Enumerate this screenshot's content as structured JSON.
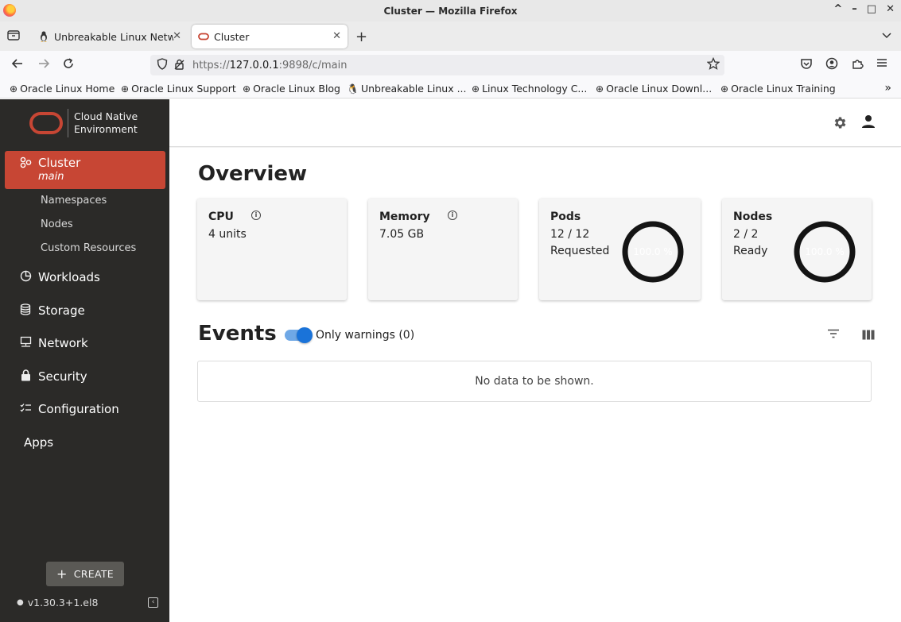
{
  "window": {
    "title": "Cluster — Mozilla Firefox",
    "controls": [
      "^",
      "–",
      "□",
      "✕"
    ]
  },
  "tabs": [
    {
      "label": "Unbreakable Linux Netw",
      "icon": "penguin-icon"
    },
    {
      "label": "Cluster",
      "icon": "oracle-oval-icon"
    }
  ],
  "urlbar": {
    "url_prefix": "https://",
    "url_host": "127.0.0.1",
    "url_rest": ":9898/c/main"
  },
  "bookmarks": [
    "Oracle Linux Home",
    "Oracle Linux Support",
    "Oracle Linux Blog",
    "Unbreakable Linux ...",
    "Linux Technology C...",
    "Oracle Linux Downl...",
    "Oracle Linux Training"
  ],
  "brand": {
    "line1": "Cloud Native",
    "line2": "Environment",
    "color": "#c74634"
  },
  "sidebar": {
    "cluster": {
      "label": "Cluster",
      "sub": "main"
    },
    "sub_items": [
      "Namespaces",
      "Nodes",
      "Custom Resources"
    ],
    "items": [
      {
        "label": "Workloads",
        "icon": "pie-chart-icon"
      },
      {
        "label": "Storage",
        "icon": "database-icon"
      },
      {
        "label": "Network",
        "icon": "monitor-network-icon"
      },
      {
        "label": "Security",
        "icon": "lock-icon"
      },
      {
        "label": "Configuration",
        "icon": "tune-list-icon"
      },
      {
        "label": "Apps",
        "icon": ""
      }
    ],
    "create_label": "CREATE",
    "version": "v1.30.3+1.el8"
  },
  "overview": {
    "title": "Overview",
    "cards": {
      "cpu": {
        "title": "CPU",
        "value": "4 units"
      },
      "memory": {
        "title": "Memory",
        "value": "7.05 GB"
      },
      "pods": {
        "title": "Pods",
        "value": "12 / 12",
        "status": "Requested",
        "percent_label": "100.0 %",
        "fraction": 1.0
      },
      "nodes": {
        "title": "Nodes",
        "value": "2 / 2",
        "status": "Ready",
        "percent_label": "100.0 %",
        "fraction": 1.0
      }
    }
  },
  "events": {
    "title": "Events",
    "toggle_label": "Only warnings (0)",
    "toggle_on": true,
    "empty_message": "No data to be shown."
  },
  "colors": {
    "sidebar_bg": "#2b2a28",
    "accent": "#c74634",
    "toggle": "#1a73d9"
  }
}
